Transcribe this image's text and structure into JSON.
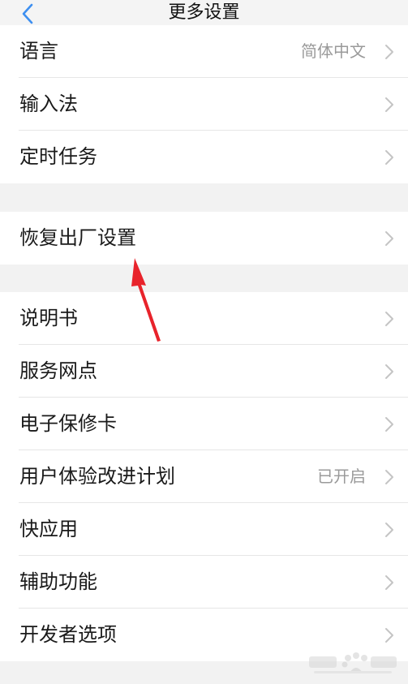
{
  "header": {
    "title": "更多设置"
  },
  "groups": [
    {
      "items": [
        {
          "label": "语言",
          "value": "简体中文"
        },
        {
          "label": "输入法"
        },
        {
          "label": "定时任务"
        }
      ]
    },
    {
      "items": [
        {
          "label": "恢复出厂设置"
        }
      ]
    },
    {
      "items": [
        {
          "label": "说明书"
        },
        {
          "label": "服务网点"
        },
        {
          "label": "电子保修卡"
        },
        {
          "label": "用户体验改进计划",
          "value": "已开启"
        },
        {
          "label": "快应用"
        },
        {
          "label": "辅助功能"
        },
        {
          "label": "开发者选项"
        }
      ]
    }
  ],
  "colors": {
    "accent": "#3d8ff0",
    "annotation_arrow": "#e8232b",
    "background": "#f2f2f2",
    "row_background": "#ffffff"
  }
}
